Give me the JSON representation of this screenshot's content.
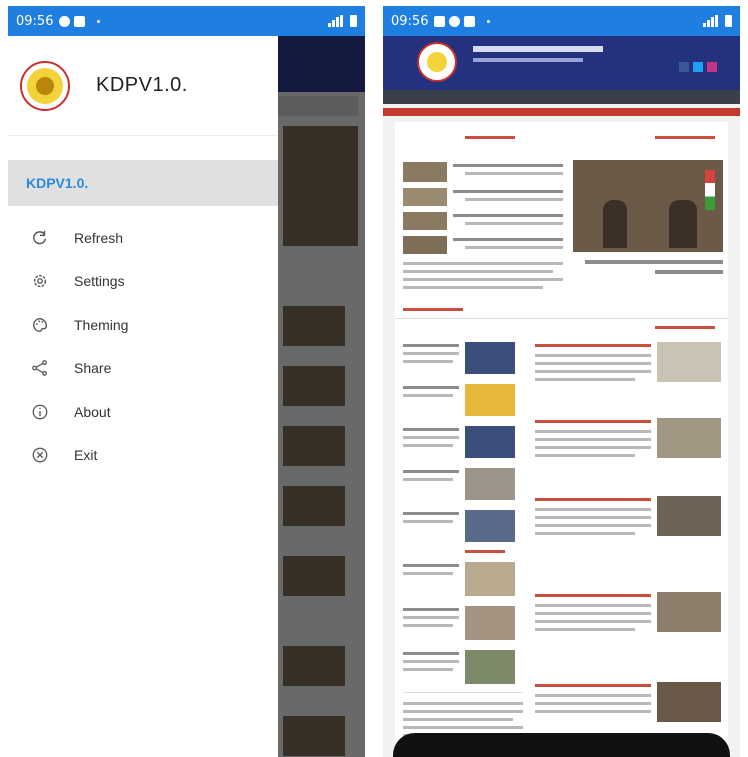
{
  "left_phone": {
    "status_bar": {
      "time": "09:56",
      "icons": [
        "settings-dot-icon",
        "lock-icon"
      ],
      "right_icons": [
        "signal-icon",
        "wifi-icon",
        "battery-icon"
      ]
    },
    "drawer": {
      "app_name": "KDPV1.0.",
      "selected_item": "KDPV1.0.",
      "menu": [
        {
          "label": "Refresh",
          "icon": "refresh-icon"
        },
        {
          "label": "Settings",
          "icon": "settings-icon"
        },
        {
          "label": "Theming",
          "icon": "palette-icon"
        },
        {
          "label": "Share",
          "icon": "share-icon"
        },
        {
          "label": "About",
          "icon": "info-icon"
        },
        {
          "label": "Exit",
          "icon": "close-circle-icon"
        }
      ]
    }
  },
  "right_phone": {
    "status_bar": {
      "time": "09:56",
      "icons": [
        "image-icon",
        "settings-dot-icon",
        "lock-icon"
      ],
      "right_icons": [
        "signal-icon",
        "wifi-icon",
        "battery-icon"
      ]
    }
  },
  "colors": {
    "status_bar": "#1f7fe0",
    "accent_link": "#2a8adf",
    "site_header": "#24317e"
  }
}
